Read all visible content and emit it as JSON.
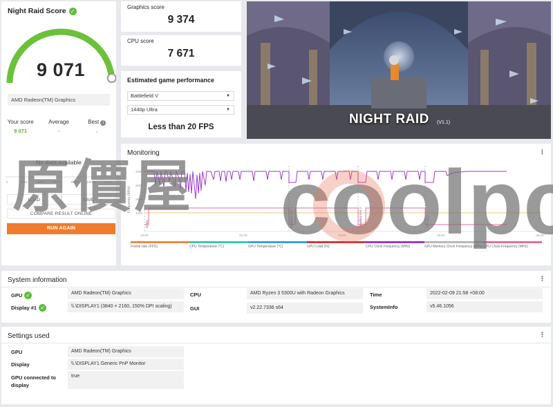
{
  "score_card": {
    "title": "Night Raid Score",
    "score": "9 071",
    "gpu_name": "AMD Radeon(TM) Graphics",
    "gauge_fraction": 0.97,
    "your_score_label": "Your score",
    "your_score_value": "9 071",
    "average_label": "Average",
    "average_value": "-",
    "best_label": "Best",
    "best_value": "-",
    "no_data": "No data available",
    "hist_ticks": [
      "0",
      "2000",
      "4000",
      "6000",
      "8000",
      "10000",
      "12000"
    ],
    "load_label": "LOAD",
    "save_label": "SAVE",
    "compare_label": "COMPARE RESULT ONLINE",
    "run_again_label": "RUN AGAIN"
  },
  "graphics": {
    "label": "Graphics score",
    "value": "9 374"
  },
  "cpu": {
    "label": "CPU score",
    "value": "7 671"
  },
  "estimate": {
    "title": "Estimated game performance",
    "game": "Battlefield V",
    "resolution": "1440p Ultra",
    "result": "Less than 20 FPS"
  },
  "hero": {
    "title": "NIGHT RAID",
    "version": "(V1.1)"
  },
  "monitoring": {
    "title": "Monitoring",
    "y_axis_label": "Frequency (MHz)",
    "y_ticks": [
      "4000",
      "3000",
      "2000",
      "1000"
    ],
    "x_ticks": [
      "00:00",
      "01:40",
      "03:20",
      "05:00",
      "06:40"
    ],
    "markers": [
      "Demo",
      "Graphics test 1",
      "Graphics test 2",
      "CPU test"
    ],
    "legend": [
      {
        "label": "Frame rate (FPS)",
        "color": "#f08a3a"
      },
      {
        "label": "CPU Temperature (°C)",
        "color": "#3cc8b4"
      },
      {
        "label": "GPU Temperature (°C)",
        "color": "#3aa0e8"
      },
      {
        "label": "GPU Load (%)",
        "color": "#d23a3a"
      },
      {
        "label": "CPU Clock Frequency (MHz)",
        "color": "#9a3ac8"
      },
      {
        "label": "GPU Memory Clock Frequency (MHz)",
        "color": "#b8b8b8"
      },
      {
        "label": "GPU Clock Frequency (MHz)",
        "color": "#e86aa8"
      }
    ]
  },
  "system_info": {
    "title": "System information",
    "gpu_label": "GPU",
    "gpu_value": "AMD Radeon(TM) Graphics",
    "display_label": "Display #1",
    "display_value": "\\\\.\\DISPLAY1 (3840 × 2160, 150% DPI scaling)",
    "cpu_label": "CPU",
    "cpu_value": "AMD Ryzen 3 5300U with Radeon Graphics",
    "gui_label": "GUI",
    "gui_value": "v2.22.7336 s64",
    "time_label": "Time",
    "time_value": "2022-02-09 21:58 +08:00",
    "sysinfo_label": "SystemInfo",
    "sysinfo_value": "v5.46.1056"
  },
  "settings": {
    "title": "Settings used",
    "gpu_label": "GPU",
    "gpu_value": "AMD Radeon(TM) Graphics",
    "display_label": "Display",
    "display_value": "\\\\.\\DISPLAY1 Generic PnP Monitor",
    "connected_label": "GPU connected to display",
    "connected_value": "true"
  },
  "watermark": {
    "cjk": "原價屋",
    "latin": "coolpc"
  }
}
